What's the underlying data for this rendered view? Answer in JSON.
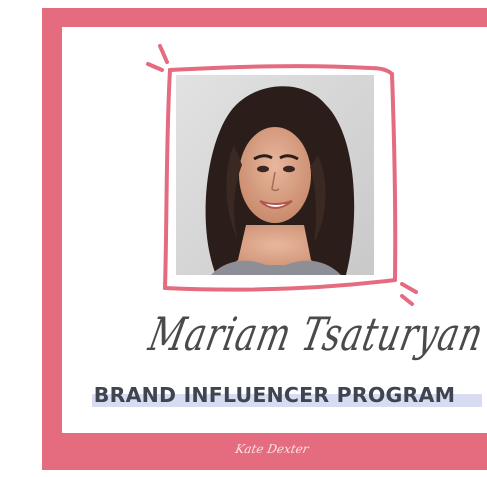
{
  "name": "Mariam Tsaturyan",
  "headline": "BRAND INFLUENCER PROGRAM",
  "footer_signature": "Kate Dexter",
  "photo": {
    "alt": "Portrait of a smiling woman with long dark curly hair"
  },
  "colors": {
    "frame": "#e56b7e",
    "highlight": "#d7dcf2",
    "headline_text": "#3f4450",
    "signature_text": "#4a4a4a"
  }
}
